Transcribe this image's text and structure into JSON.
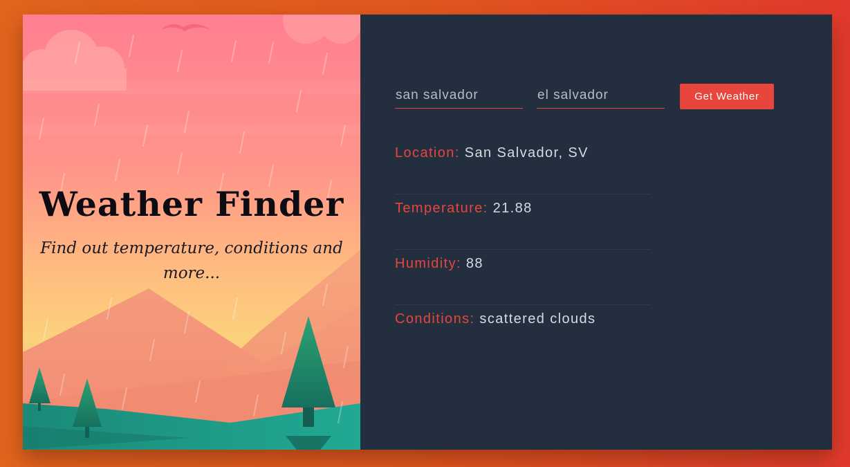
{
  "hero": {
    "title": "Weather Finder",
    "subtitle": "Find out temperature, conditions and more..."
  },
  "form": {
    "city_value": "san salvador",
    "country_value": "el salvador",
    "submit_label": "Get Weather"
  },
  "results": {
    "location": {
      "label": "Location:",
      "value": "San Salvador, SV"
    },
    "temperature": {
      "label": "Temperature:",
      "value": "21.88"
    },
    "humidity": {
      "label": "Humidity:",
      "value": "88"
    },
    "conditions": {
      "label": "Conditions:",
      "value": "scattered clouds"
    }
  },
  "colors": {
    "accent": "#e8453c",
    "panel_bg": "#232f3f",
    "page_bg_start": "#e2651d",
    "page_bg_end": "#e23a2d",
    "tree": "#1f7c63",
    "ground": "#1f9c87"
  },
  "icons": [
    "bird-icon",
    "cloud-icon",
    "rain-drops",
    "pine-tree-icon",
    "mountain-shape"
  ]
}
